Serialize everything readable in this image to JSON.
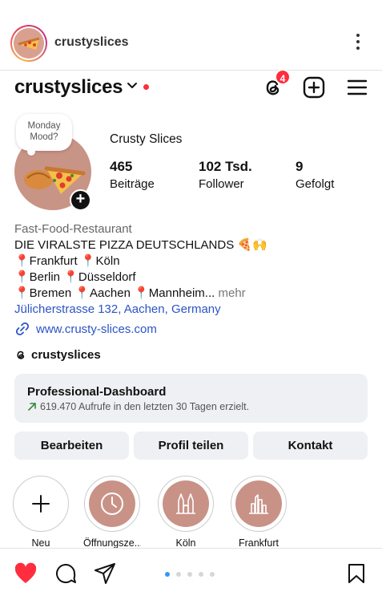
{
  "top_bar": {
    "username": "crustyslices"
  },
  "profile_header": {
    "username": "crustyslices",
    "notification_count": "4"
  },
  "note": {
    "text": "Monday Mood?"
  },
  "profile": {
    "display_name": "Crusty Slices",
    "stats": [
      {
        "value": "465",
        "label": "Beiträge"
      },
      {
        "value": "102 Tsd.",
        "label": "Follower"
      },
      {
        "value": "9",
        "label": "Gefolgt"
      }
    ]
  },
  "bio": {
    "category": "Fast-Food-Restaurant",
    "headline": "DIE VIRALSTE PIZZA DEUTSCHLANDS 🍕🙌",
    "line1": "📍Frankfurt 📍Köln",
    "line2": "📍Berlin 📍Düsseldorf",
    "line3": "📍Bremen 📍Aachen 📍Mannheim...",
    "more": "mehr",
    "address": "Jülicherstrasse 132, Aachen, Germany",
    "website": "www.crusty-slices.com",
    "threads_handle": "crustyslices"
  },
  "dashboard": {
    "title": "Professional-Dashboard",
    "subtitle": "619.470 Aufrufe in den letzten 30 Tagen erzielt."
  },
  "buttons": {
    "edit": "Bearbeiten",
    "share": "Profil teilen",
    "contact": "Kontakt"
  },
  "highlights": [
    {
      "label": "Neu"
    },
    {
      "label": "Öffnungsze..."
    },
    {
      "label": "Köln"
    },
    {
      "label": "Frankfurt"
    }
  ],
  "colors": {
    "accent_red": "#ff2d3d",
    "link_blue": "#2b54c7",
    "heart_red": "#ff2d3d",
    "active_dot": "#3897f0"
  }
}
